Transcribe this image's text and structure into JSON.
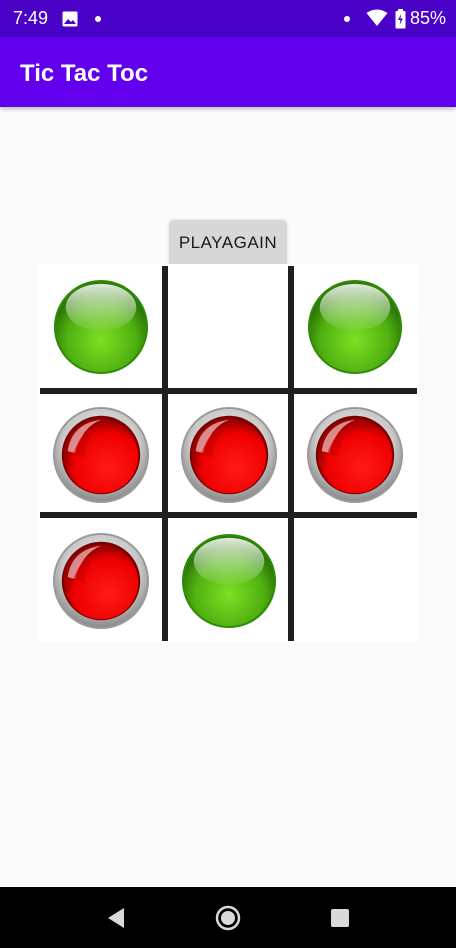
{
  "status_bar": {
    "time": "7:49",
    "battery": "85%",
    "icons": [
      "photo-icon",
      "dot-icon",
      "dot-icon",
      "wifi-icon",
      "battery-icon"
    ]
  },
  "app_bar": {
    "title": "Tic Tac Toc",
    "color": "#6200ee"
  },
  "game": {
    "play_again_label": "PLAYAGAIN",
    "board": [
      [
        "green",
        "empty",
        "green"
      ],
      [
        "red",
        "red",
        "red"
      ],
      [
        "red",
        "green",
        "empty"
      ]
    ],
    "colors": {
      "green": "#5cc414",
      "red": "#ff0000",
      "grid": "#1f1f1f"
    }
  },
  "nav_bar": {
    "icons": [
      "back-icon",
      "home-icon",
      "recents-icon"
    ]
  }
}
